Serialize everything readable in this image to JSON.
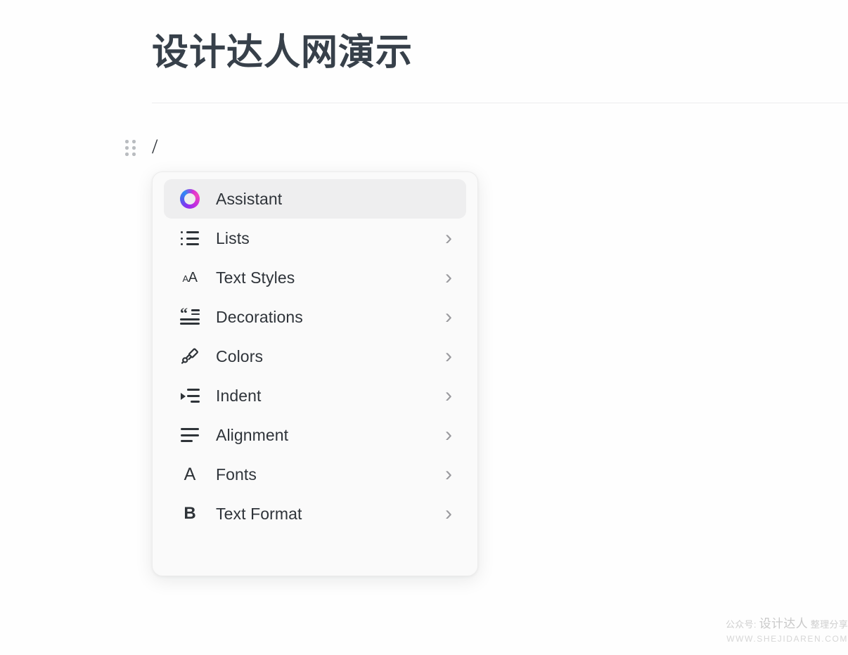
{
  "page": {
    "background_color": "#fefefe",
    "title": "设计达人网演示",
    "title_color": "#37404a"
  },
  "block": {
    "drag_handle_name": "drag-handle",
    "typed_text": "/"
  },
  "slash_menu": {
    "selected_index": 0,
    "selected_bg": "#eeeeef",
    "panel_bg": "#fafafa",
    "items": [
      {
        "label": "Assistant",
        "icon": "assistant-ring-icon",
        "has_submenu": false
      },
      {
        "label": "Lists",
        "icon": "bulleted-list-icon",
        "has_submenu": true
      },
      {
        "label": "Text Styles",
        "icon": "text-styles-aa-icon",
        "has_submenu": true
      },
      {
        "label": "Decorations",
        "icon": "blockquote-icon",
        "has_submenu": true
      },
      {
        "label": "Colors",
        "icon": "paintbrush-icon",
        "has_submenu": true
      },
      {
        "label": "Indent",
        "icon": "indent-icon",
        "has_submenu": true
      },
      {
        "label": "Alignment",
        "icon": "align-left-icon",
        "has_submenu": true
      },
      {
        "label": "Fonts",
        "icon": "font-a-icon",
        "has_submenu": true
      },
      {
        "label": "Text Format",
        "icon": "bold-b-icon",
        "has_submenu": true
      }
    ],
    "chevron_glyph": "›"
  },
  "watermark": {
    "prefix": "公众号:",
    "brand": "设计达人",
    "suffix": "整理分享",
    "url": "WWW.SHEJIDAREN.COM"
  }
}
